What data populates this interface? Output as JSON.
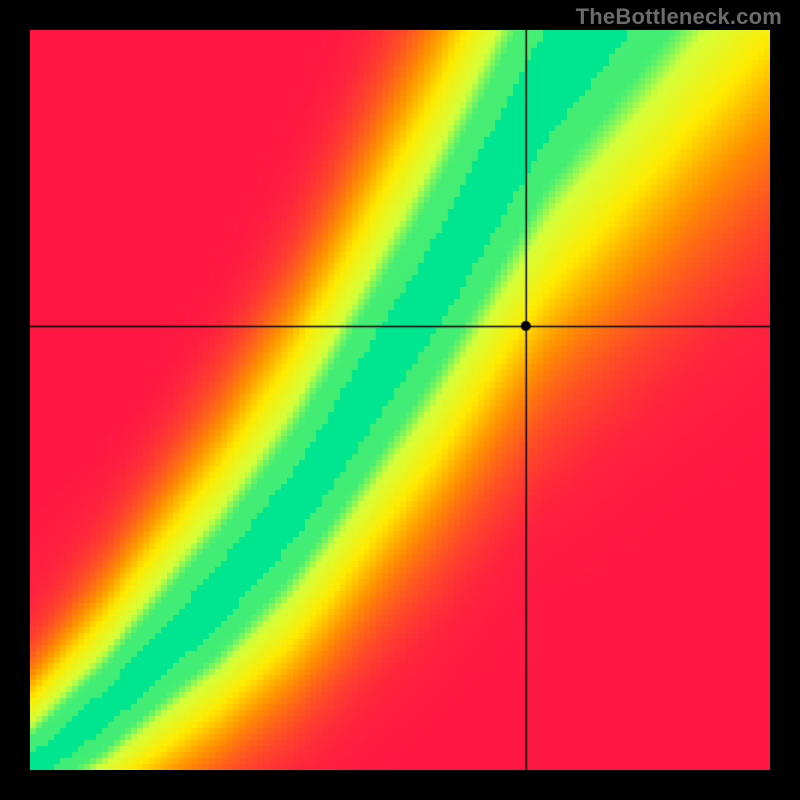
{
  "watermark": "TheBottleneck.com",
  "chart_data": {
    "type": "heatmap",
    "title": "",
    "xlabel": "",
    "ylabel": "",
    "xlim": [
      0,
      1
    ],
    "ylim": [
      0,
      1
    ],
    "marker": {
      "x": 0.67,
      "y": 0.6
    },
    "crosshair": {
      "x": 0.67,
      "y": 0.6
    },
    "optimal_curve": {
      "description": "Green ridge: GPU score (y) that balances a given CPU score (x). Normalized 0-1.",
      "points": [
        {
          "x": 0.0,
          "y": 0.0
        },
        {
          "x": 0.05,
          "y": 0.04
        },
        {
          "x": 0.1,
          "y": 0.08
        },
        {
          "x": 0.15,
          "y": 0.13
        },
        {
          "x": 0.2,
          "y": 0.18
        },
        {
          "x": 0.25,
          "y": 0.23
        },
        {
          "x": 0.3,
          "y": 0.29
        },
        {
          "x": 0.35,
          "y": 0.35
        },
        {
          "x": 0.4,
          "y": 0.42
        },
        {
          "x": 0.45,
          "y": 0.5
        },
        {
          "x": 0.5,
          "y": 0.58
        },
        {
          "x": 0.55,
          "y": 0.66
        },
        {
          "x": 0.6,
          "y": 0.75
        },
        {
          "x": 0.65,
          "y": 0.84
        },
        {
          "x": 0.7,
          "y": 0.93
        },
        {
          "x": 0.75,
          "y": 1.0
        }
      ]
    },
    "color_stops": [
      {
        "value": 0.0,
        "color": "#ff1744"
      },
      {
        "value": 0.35,
        "color": "#ff9100"
      },
      {
        "value": 0.6,
        "color": "#ffea00"
      },
      {
        "value": 0.85,
        "color": "#d4ff3a"
      },
      {
        "value": 1.0,
        "color": "#00e58f"
      }
    ]
  }
}
